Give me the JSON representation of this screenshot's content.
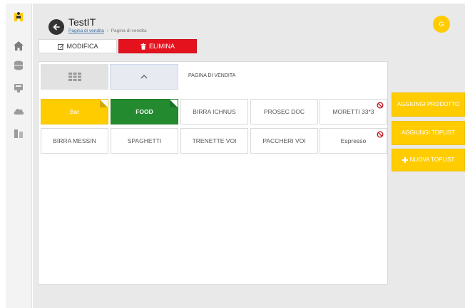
{
  "header": {
    "title": "TestIT",
    "breadcrumb": {
      "link": "Pagina di vendita",
      "current": "Pagina di vendita"
    },
    "avatar_initial": "G"
  },
  "toolbar": {
    "edit_label": "MODIFICA",
    "delete_label": "ELIMINA"
  },
  "panel": {
    "page_label": "PAGINA DI VENDITA",
    "tiles": [
      {
        "label": "Bar",
        "style": "yellow",
        "corner": "fold"
      },
      {
        "label": "FOOD",
        "style": "green",
        "corner": "fold"
      },
      {
        "label": "BIRRA ICHNUS",
        "style": "white",
        "corner": ""
      },
      {
        "label": "PROSEC DOC",
        "style": "white",
        "corner": ""
      },
      {
        "label": "MORETTI 33*3",
        "style": "white",
        "corner": "ban"
      },
      {
        "label": "BIRRA MESSIN",
        "style": "white",
        "corner": ""
      },
      {
        "label": "SPAGHETTI",
        "style": "white",
        "corner": ""
      },
      {
        "label": "TRENETTE VOI",
        "style": "white",
        "corner": ""
      },
      {
        "label": "PACCHERI VOI",
        "style": "white",
        "corner": ""
      },
      {
        "label": "Espresso",
        "style": "white",
        "corner": "ban"
      }
    ]
  },
  "actions": {
    "add_product": "AGGIUNGI PRODOTTO",
    "add_toplist": "AGGIUNGI TOPLIST",
    "new_toplist": "NUOVA TOPLIST"
  },
  "colors": {
    "accent_yellow": "#ffcc00",
    "delete_red": "#e4121d",
    "food_green": "#238a2f"
  },
  "icons": [
    "logo-icon",
    "home-icon",
    "database-icon",
    "register-icon",
    "cloud-icon",
    "doors-icon",
    "back-arrow-icon",
    "edit-icon",
    "trash-icon",
    "grid-icon",
    "chevron-up-icon",
    "ban-icon",
    "plus-icon"
  ]
}
